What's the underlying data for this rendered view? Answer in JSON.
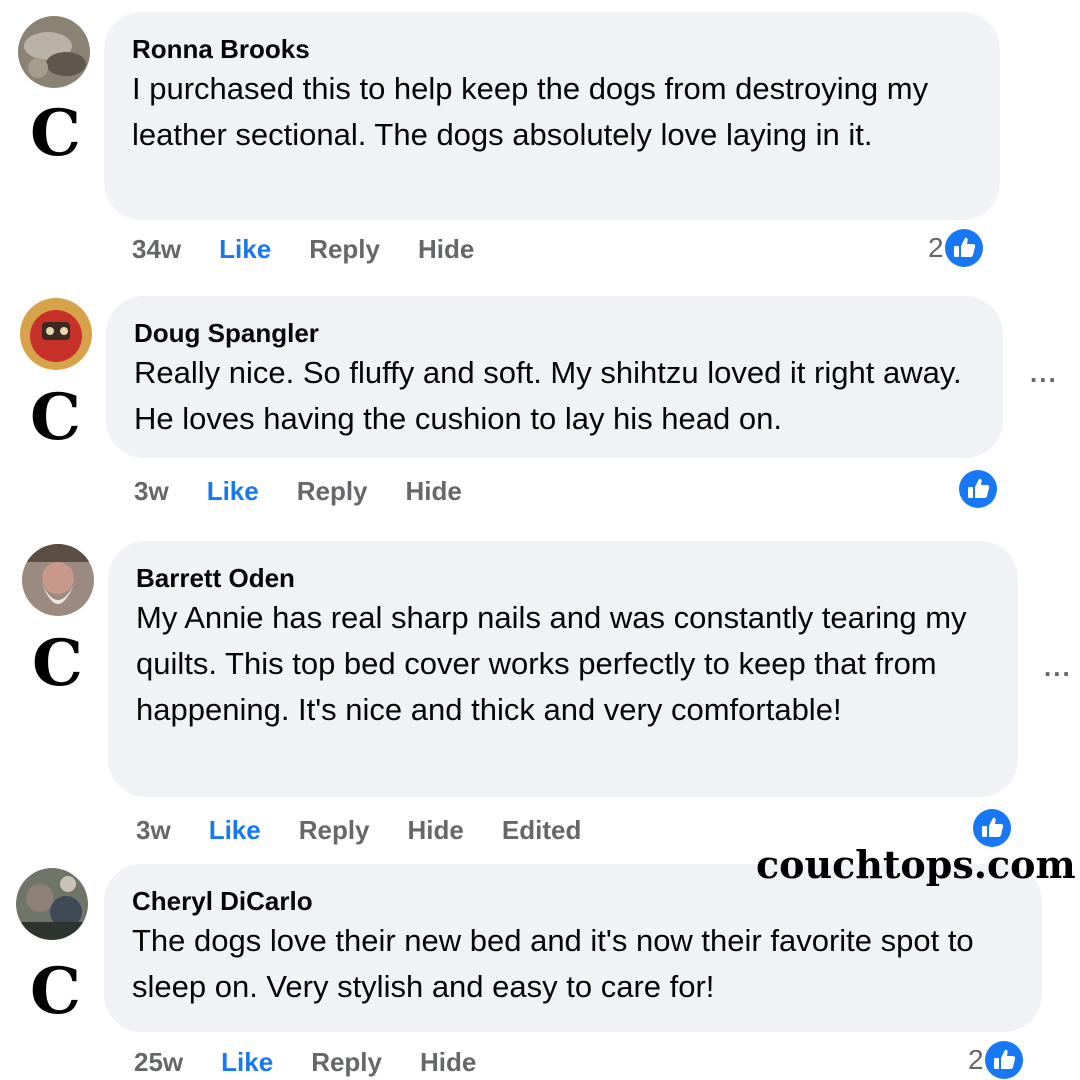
{
  "comments": [
    {
      "author": "Ronna Brooks",
      "text": "I purchased this to help keep the dogs from destroying my leather sectional. The dogs absolutely love laying in it.",
      "time": "34w",
      "like_label": "Like",
      "reply_label": "Reply",
      "hide_label": "Hide",
      "reaction_count": "2"
    },
    {
      "author": "Doug Spangler",
      "text": "Really nice. So fluffy and soft. My shihtzu loved it right away. He loves having the cushion to lay his head on.",
      "time": "3w",
      "like_label": "Like",
      "reply_label": "Reply",
      "hide_label": "Hide",
      "more_label": "..."
    },
    {
      "author": "Barrett Oden",
      "text": "My Annie has real sharp nails and was constantly tearing my quilts. This top bed cover works perfectly to keep that from happening. It's nice and thick and very comfortable!",
      "time": "3w",
      "like_label": "Like",
      "reply_label": "Reply",
      "hide_label": "Hide",
      "edited_label": "Edited",
      "more_label": "..."
    },
    {
      "author": "Cheryl DiCarlo",
      "text": "The dogs love their new bed and it's now their favorite spot to sleep on. Very stylish and easy to care for!",
      "time": "25w",
      "like_label": "Like",
      "reply_label": "Reply",
      "hide_label": "Hide",
      "reaction_count": "2"
    }
  ],
  "brand_mark": "C",
  "watermark": "couchtops.com",
  "icons": {
    "like": "thumbs-up-icon",
    "more": "more-options-icon"
  },
  "colors": {
    "like_blue": "#1877f2",
    "bubble_bg": "#f0f2f5",
    "meta_gray": "#65676b"
  }
}
